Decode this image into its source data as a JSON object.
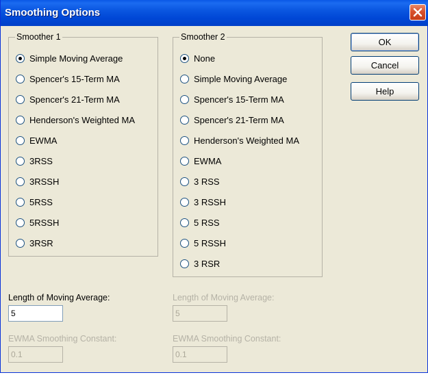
{
  "title": "Smoothing Options",
  "smoother1": {
    "title": "Smoother 1",
    "selected": 0,
    "options": [
      "Simple Moving Average",
      "Spencer's 15-Term MA",
      "Spencer's 21-Term MA",
      "Henderson's Weighted MA",
      "EWMA",
      "3RSS",
      "3RSSH",
      "5RSS",
      "5RSSH",
      "3RSR"
    ]
  },
  "smoother2": {
    "title": "Smoother 2",
    "selected": 0,
    "options": [
      "None",
      "Simple Moving Average",
      "Spencer's 15-Term MA",
      "Spencer's 21-Term MA",
      "Henderson's Weighted MA",
      "EWMA",
      "3 RSS",
      "3 RSSH",
      "5 RSS",
      "5 RSSH",
      "3 RSR"
    ]
  },
  "buttons": {
    "ok": "OK",
    "cancel": "Cancel",
    "help": "Help"
  },
  "fields": {
    "length1_label": "Length of Moving Average:",
    "length1_value": "5",
    "length2_label": "Length of Moving Average:",
    "length2_value": "5",
    "ewma1_label": "EWMA Smoothing Constant:",
    "ewma1_value": "0.1",
    "ewma2_label": "EWMA Smoothing Constant:",
    "ewma2_value": "0.1"
  }
}
